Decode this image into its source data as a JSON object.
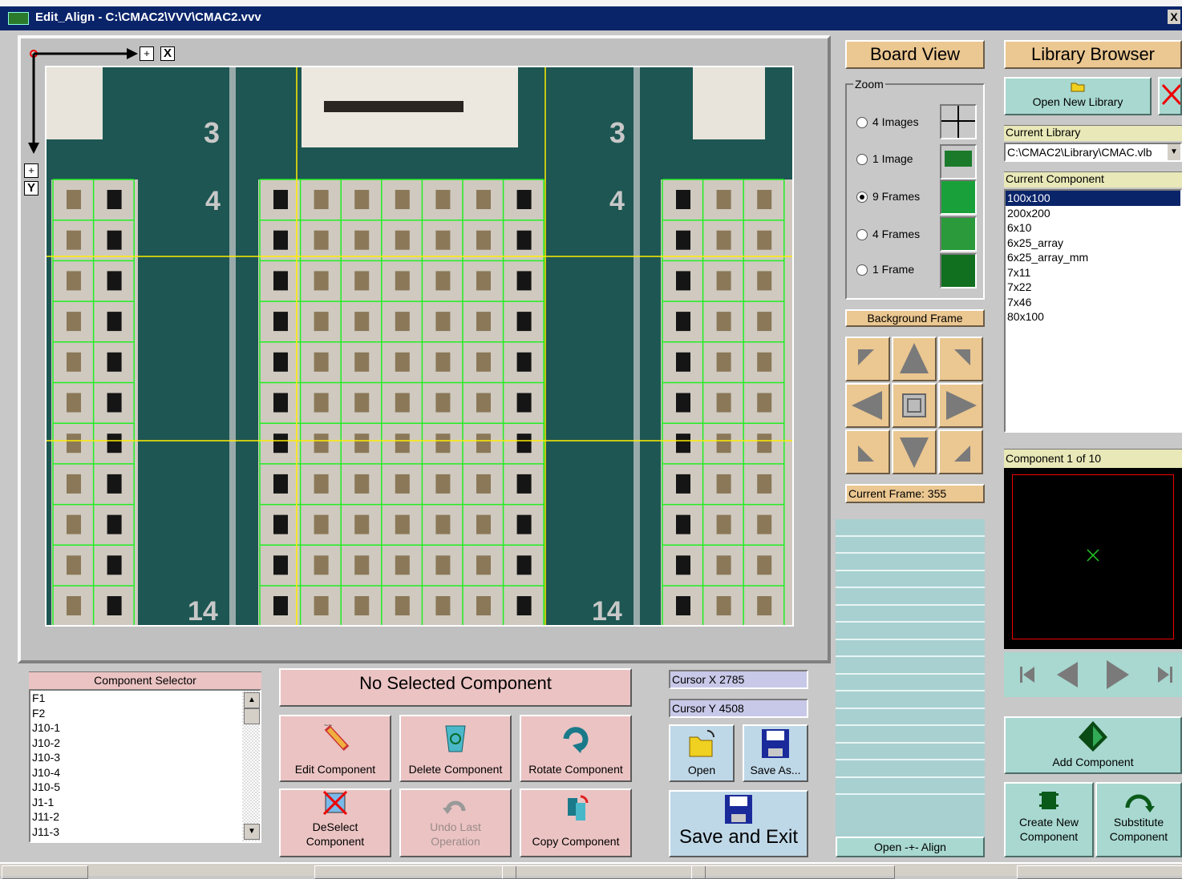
{
  "window": {
    "title": "Edit_Align - C:\\CMAC2\\VVV\\CMAC2.vvv",
    "close_label": "X"
  },
  "viewer": {
    "x_axis_plus": "+",
    "x_axis_label": "X",
    "y_axis_plus": "+",
    "y_axis_label": "Y",
    "board_labels": [
      "3",
      "4",
      "3",
      "4",
      "14",
      "14"
    ]
  },
  "board_view": {
    "title": "Board View",
    "zoom_label": "Zoom",
    "zoom_options": [
      {
        "label": "4 Images",
        "selected": false
      },
      {
        "label": "1 Image",
        "selected": false
      },
      {
        "label": "9 Frames",
        "selected": true
      },
      {
        "label": "4 Frames",
        "selected": false
      },
      {
        "label": "1 Frame",
        "selected": false
      }
    ],
    "background_frame": "Background Frame",
    "current_frame": "Current Frame: 355"
  },
  "library_browser": {
    "title": "Library Browser",
    "open_new_library": "Open New Library",
    "current_library_label": "Current Library",
    "current_library_value": "C:\\CMAC2\\Library\\CMAC.vlb",
    "current_component_label": "Current Component",
    "components": [
      "100x100",
      "200x200",
      "6x10",
      "6x25_array",
      "6x25_array_mm",
      "7x11",
      "7x22",
      "7x46",
      "80x100"
    ],
    "selected_component": "100x100",
    "component_count": "Component 1 of 10",
    "add_component": "Add Component",
    "create_new_component": "Create New Component",
    "substitute_component": "Substitute Component"
  },
  "component_selector": {
    "title": "Component Selector",
    "items": [
      "F1",
      "F2",
      "J10-1",
      "J10-2",
      "J10-3",
      "J10-4",
      "J10-5",
      "J1-1",
      "J11-2",
      "J11-3"
    ]
  },
  "actions": {
    "status": "No Selected Component",
    "edit": "Edit Component",
    "delete": "Delete Component",
    "rotate": "Rotate Component",
    "deselect": "DeSelect Component",
    "undo": "Undo Last Operation",
    "copy": "Copy Component"
  },
  "cursor": {
    "x": "Cursor X  2785",
    "y": "Cursor Y  4508"
  },
  "file": {
    "open": "Open",
    "save_as": "Save As...",
    "save_exit": "Save and Exit"
  },
  "align_button": "Open -+- Align",
  "colors": {
    "title_bar": "#0a246a",
    "board_bg": "#1d5652",
    "tan": "#ebc791",
    "pink": "#ebc3c3",
    "cyan": "#a8d0d0",
    "grid_green": "#22ee22"
  }
}
